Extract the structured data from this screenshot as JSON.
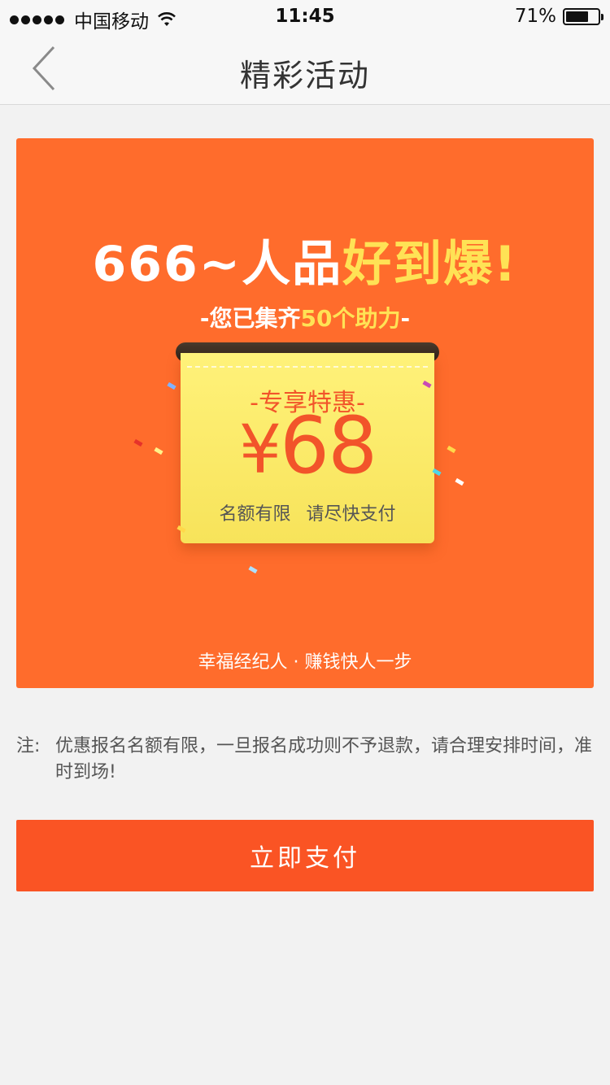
{
  "status_bar": {
    "carrier": "中国移动",
    "time": "11:45",
    "battery": "71%",
    "battery_level": 0.71
  },
  "navbar": {
    "title": "精彩活动",
    "back_icon": "chevron-left-icon"
  },
  "banner": {
    "headline_white": "666~人品",
    "headline_yellow": "好到爆!",
    "subline_prefix": "-您已集齐",
    "subline_highlight": "50个助力",
    "subline_suffix": "-",
    "coupon_tag": "-专享特惠-",
    "coupon_currency": "¥",
    "coupon_amount": "68",
    "coupon_note": "名额有限 请尽快支付",
    "slogan": "幸福经纪人 · 赚钱快人一步",
    "colors": {
      "background": "#ff6c2c",
      "highlight": "#ffe255",
      "price": "#f2542a"
    }
  },
  "notice": {
    "label": "注:",
    "text": "优惠报名名额有限，一旦报名成功则不予退款，请合理安排时间，准时到场!"
  },
  "pay_button": {
    "label": "立即支付",
    "color": "#fa5424"
  }
}
